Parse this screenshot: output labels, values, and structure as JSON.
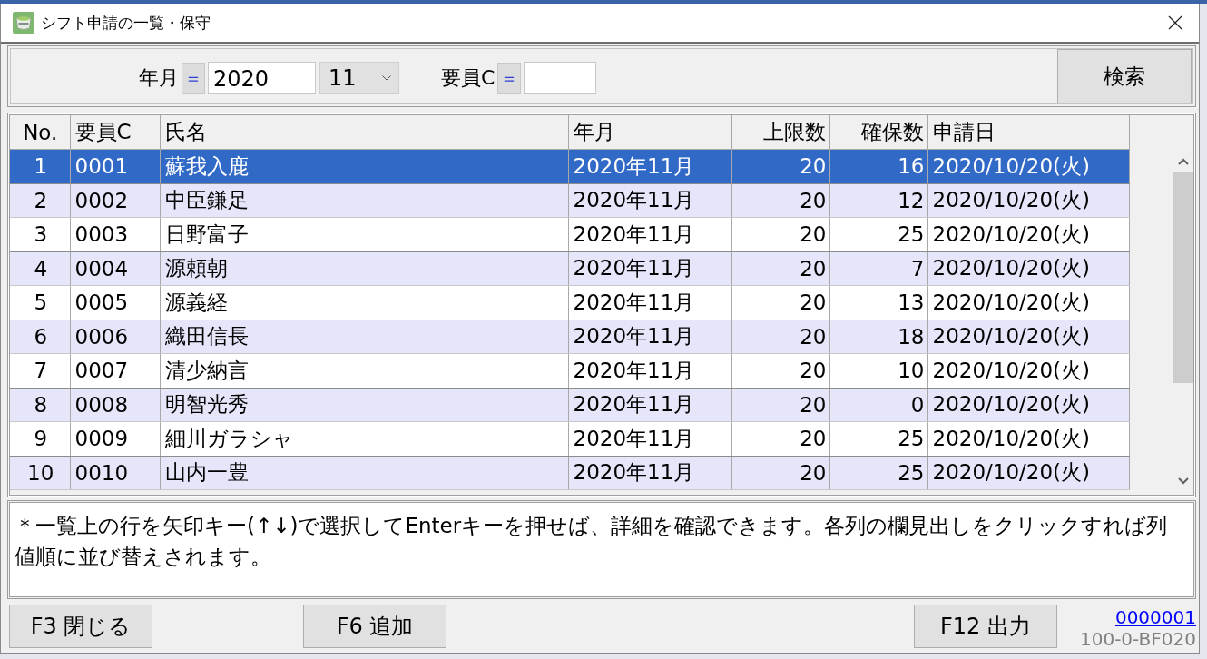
{
  "window": {
    "title": "シフト申請の一覧・保守"
  },
  "search": {
    "year_month": {
      "label": "年月",
      "operator": "＝",
      "year": "2020",
      "month": "11"
    },
    "staff_code": {
      "label": "要員C",
      "operator": "＝"
    },
    "button": "検索"
  },
  "table": {
    "columns": [
      "No.",
      "要員C",
      "氏名",
      "年月",
      "上限数",
      "確保数",
      "申請日"
    ],
    "rows": [
      {
        "cells": [
          "1",
          "0001",
          "蘇我入鹿",
          "2020年11月",
          "20",
          "16",
          "2020/10/20(火)"
        ],
        "selected": true
      },
      {
        "cells": [
          "2",
          "0002",
          "中臣鎌足",
          "2020年11月",
          "20",
          "12",
          "2020/10/20(火)"
        ],
        "selected": false
      },
      {
        "cells": [
          "3",
          "0003",
          "日野富子",
          "2020年11月",
          "20",
          "25",
          "2020/10/20(火)"
        ],
        "selected": false
      },
      {
        "cells": [
          "4",
          "0004",
          "源頼朝",
          "2020年11月",
          "20",
          "7",
          "2020/10/20(火)"
        ],
        "selected": false
      },
      {
        "cells": [
          "5",
          "0005",
          "源義経",
          "2020年11月",
          "20",
          "13",
          "2020/10/20(火)"
        ],
        "selected": false
      },
      {
        "cells": [
          "6",
          "0006",
          "織田信長",
          "2020年11月",
          "20",
          "18",
          "2020/10/20(火)"
        ],
        "selected": false
      },
      {
        "cells": [
          "7",
          "0007",
          "清少納言",
          "2020年11月",
          "20",
          "10",
          "2020/10/20(火)"
        ],
        "selected": false
      },
      {
        "cells": [
          "8",
          "0008",
          "明智光秀",
          "2020年11月",
          "20",
          "0",
          "2020/10/20(火)"
        ],
        "selected": false
      },
      {
        "cells": [
          "9",
          "0009",
          "細川ガラシャ",
          "2020年11月",
          "20",
          "25",
          "2020/10/20(火)"
        ],
        "selected": false
      },
      {
        "cells": [
          "10",
          "0010",
          "山内一豊",
          "2020年11月",
          "20",
          "25",
          "2020/10/20(火)"
        ],
        "selected": false
      }
    ]
  },
  "hint": "＊一覧上の行を矢印キー(↑↓)で選択してEnterキーを押せば、詳細を確認できます。各列の欄見出しをクリックすれば列値順に並び替えされます。",
  "footer": {
    "buttons": [
      "F3 閉じる",
      "F6 追加",
      "F12 出力"
    ],
    "record_link": "0000001",
    "form_code": "100-0-BF020"
  }
}
